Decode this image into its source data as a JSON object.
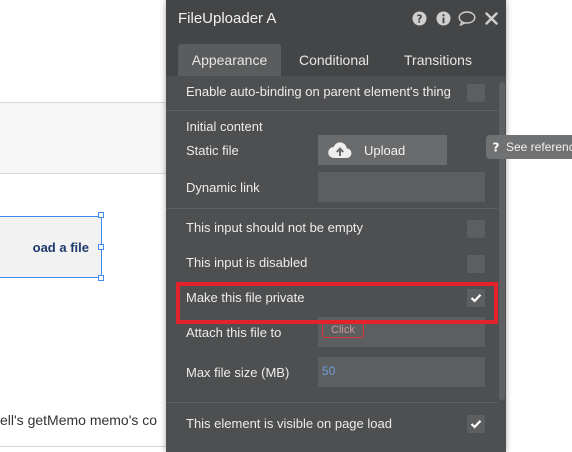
{
  "canvas": {
    "selected_element_text": "oad a file",
    "bottom_text": "ell's getMemo memo's co"
  },
  "panel": {
    "title": "FileUploader A",
    "header_icons": [
      "help-icon",
      "info-icon",
      "comment-icon",
      "close-icon"
    ],
    "tabs": [
      {
        "label": "Appearance",
        "active": true
      },
      {
        "label": "Conditional",
        "active": false
      },
      {
        "label": "Transitions",
        "active": false
      }
    ],
    "rows": {
      "auto_binding": {
        "label": "Enable auto-binding on parent element's thing",
        "checked": false
      },
      "initial_content_heading": "Initial content",
      "static_file": {
        "label": "Static file",
        "button": "Upload"
      },
      "dynamic_link": {
        "label": "Dynamic link",
        "value": ""
      },
      "not_empty": {
        "label": "This input should not be empty",
        "checked": false
      },
      "disabled": {
        "label": "This input is disabled",
        "checked": false
      },
      "private_file": {
        "label": "Make this file private",
        "checked": true
      },
      "attach_to": {
        "label": "Attach this file to",
        "chip": "Click"
      },
      "max_size": {
        "label": "Max file size (MB)",
        "value": "50"
      },
      "visible_on_load": {
        "label": "This element is visible on page load",
        "checked": true
      }
    }
  },
  "tooltip": {
    "text": "See referenc"
  },
  "colors": {
    "panel_bg": "#4e4f50",
    "highlight": "#e3222a",
    "selection": "#3c8be8"
  }
}
